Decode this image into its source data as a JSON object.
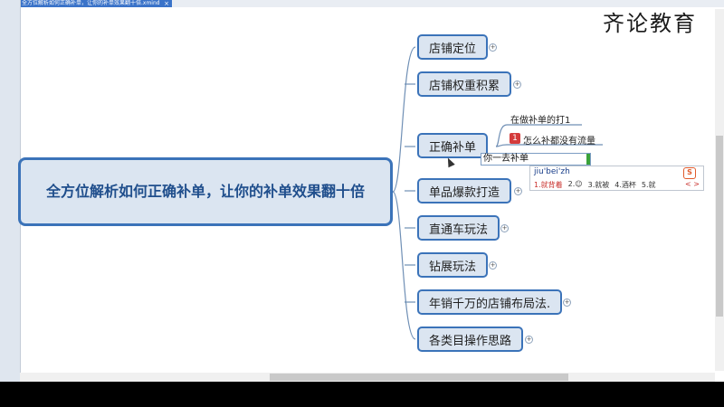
{
  "window": {
    "tab_title": "全方位解析如何正确补单，让你的补单效果翻十倍.xmind",
    "close_label": "×"
  },
  "watermark": "齐论教育",
  "mindmap": {
    "root": "全方位解析如何正确补单，让你的补单效果翻十倍",
    "topics": [
      "店铺定位",
      "店铺权重积累",
      "正确补单",
      "单品爆款打造",
      "直通车玩法",
      "钻展玩法",
      "年销千万的店铺布局法.",
      "各类目操作思路"
    ],
    "expand_glyph": "+",
    "subtopics": {
      "first": "在做补单的打1",
      "badge": "1",
      "second": "怎么补都没有流量"
    },
    "editing_value": "你一去补单"
  },
  "ime": {
    "pinyin": "jiu'bei'zh",
    "logo": "S",
    "candidates": [
      "1.就背着",
      "2.☺",
      "3.就被",
      "4.酒杯",
      "5.就"
    ],
    "arrows": "< >"
  },
  "colors": {
    "topic_fill": "#dbe5f1",
    "topic_border": "#3b73b9",
    "root_text": "#1f4e8c",
    "connector": "#6f8fb5"
  }
}
